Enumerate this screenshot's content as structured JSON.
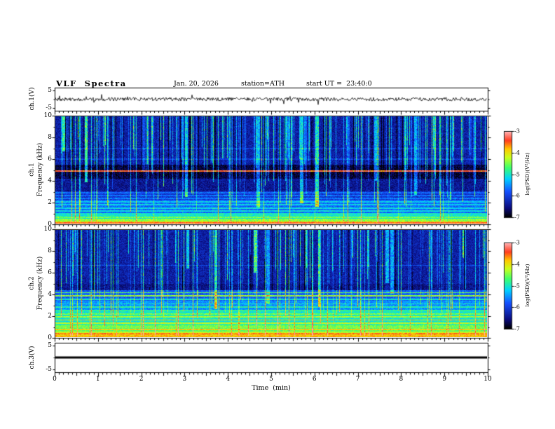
{
  "header": {
    "title": "VLF  Spectra",
    "date": "Jan. 20, 2026",
    "station": "station=ATH",
    "start_ut": "start UT =  23:40:0"
  },
  "axes": {
    "x_title": "Time  (min)",
    "x_tick_labels": [
      "0",
      "1",
      "2",
      "3",
      "4",
      "5",
      "6",
      "7",
      "8",
      "9",
      "10"
    ],
    "spec_y_tick_labels": [
      "10",
      "8",
      "6",
      "4",
      "2",
      "0"
    ],
    "volt_y_tick_labels": [
      "5",
      "-5"
    ],
    "colorbar_tick_labels": [
      "-3",
      "-4",
      "-5",
      "-6",
      "-7"
    ],
    "colorbar_title": "log(PSD)(V²/Hz)"
  },
  "panel_labels": {
    "ch1_wave": "ch.1(V)",
    "spec1_line1": "ch.1",
    "spec1_line2": "Frequency (kHz)",
    "spec2_line1": "ch.2",
    "spec2_line2": "Frequency (kHz)",
    "ch3_wave": "ch.3(V)"
  },
  "colors": {
    "background": "#ffffff",
    "frame": "#000000",
    "trace": "#000000",
    "colormap_stops": [
      [
        0.0,
        "#000000"
      ],
      [
        0.1,
        "#0a0a78"
      ],
      [
        0.3,
        "#1450ff"
      ],
      [
        0.45,
        "#00d2ff"
      ],
      [
        0.58,
        "#3cff6e"
      ],
      [
        0.7,
        "#c8ff1e"
      ],
      [
        0.8,
        "#ffc800"
      ],
      [
        0.9,
        "#ff3c1e"
      ],
      [
        1.0,
        "#ffaaaa"
      ]
    ]
  },
  "chart_data": [
    {
      "type": "line",
      "name": "ch1-voltage-waveform",
      "ylabel": "ch.1(V)",
      "xlim": [
        0,
        10
      ],
      "ylim": [
        -5,
        5
      ],
      "yticks": [
        5,
        -5
      ],
      "baseline_v": 0,
      "noise_amplitude_v": 0.8,
      "spike_rate": 0.035,
      "spike_amplitude_v": 2.5,
      "description": "continuous broadband noise trace centered on 0 V with sporadic impulsive spikes"
    },
    {
      "type": "heatmap",
      "name": "ch1-spectrogram",
      "ylabel": "ch.1 Frequency (kHz)",
      "xlim": [
        0,
        10
      ],
      "ylim": [
        0,
        10
      ],
      "yticks": [
        0,
        2,
        4,
        6,
        8,
        10
      ],
      "clim": [
        -7,
        -3
      ],
      "colorbar_label": "log(PSD)(V²/Hz)",
      "noise": 0.55,
      "bands": [
        {
          "f": [
            0,
            0.2
          ],
          "psd": -3.8
        },
        {
          "f": [
            0.2,
            0.45
          ],
          "psd": -4.4
        },
        {
          "f": [
            0.45,
            1.0
          ],
          "psd": -5.0
        },
        {
          "f": [
            1.0,
            2.2
          ],
          "psd": -5.7
        },
        {
          "f": [
            2.2,
            3.0
          ],
          "psd": -6.1
        },
        {
          "f": [
            3.0,
            4.2
          ],
          "psd": -6.45
        },
        {
          "f": [
            4.2,
            5.5
          ],
          "psd": -6.8
        },
        {
          "f": [
            5.5,
            10.01
          ],
          "psd": -6.35
        }
      ],
      "lines": [
        {
          "f": 0.08,
          "psd": -3.5
        },
        {
          "f": 0.6,
          "psd": -4.5
        },
        {
          "f": 1.15,
          "psd": -5.1
        },
        {
          "f": 1.45,
          "psd": -5.1
        },
        {
          "f": 1.75,
          "psd": -5.15
        },
        {
          "f": 2.0,
          "psd": -5.2
        },
        {
          "f": 2.35,
          "psd": -5.6
        },
        {
          "f": 2.6,
          "psd": -5.65
        },
        {
          "f": 2.85,
          "psd": -5.7
        },
        {
          "f": 4.9,
          "psd": -3.4
        },
        {
          "f": 6.0,
          "psd": -6.0
        },
        {
          "f": 7.0,
          "psd": -6.05
        }
      ],
      "streaks": {
        "prob": 0.3,
        "burst_prob": 0.02,
        "dark_prob": 0.1,
        "boost": [
          0.6,
          2.2
        ]
      },
      "description": "blue background with dense vertical sferic streaks above ~5 kHz, dark band 4.2-5.5 kHz, bright green/yellow/red layers below 1 kHz"
    },
    {
      "type": "heatmap",
      "name": "ch2-spectrogram",
      "ylabel": "ch.2 Frequency (kHz)",
      "xlim": [
        0,
        10
      ],
      "ylim": [
        0,
        10
      ],
      "yticks": [
        0,
        2,
        4,
        6,
        8,
        10
      ],
      "clim": [
        -7,
        -3
      ],
      "colorbar_label": "log(PSD)(V²/Hz)",
      "noise": 0.55,
      "bands": [
        {
          "f": [
            0,
            0.25
          ],
          "psd": -3.8
        },
        {
          "f": [
            0.25,
            0.5
          ],
          "psd": -4.2
        },
        {
          "f": [
            0.5,
            1.2
          ],
          "psd": -4.6
        },
        {
          "f": [
            1.2,
            2.4
          ],
          "psd": -5.0
        },
        {
          "f": [
            2.4,
            3.4
          ],
          "psd": -5.5
        },
        {
          "f": [
            3.4,
            4.4
          ],
          "psd": -5.8
        },
        {
          "f": [
            4.4,
            5.0
          ],
          "psd": -6.5
        },
        {
          "f": [
            5.0,
            10.01
          ],
          "psd": -6.35
        }
      ],
      "lines": [
        {
          "f": 0.35,
          "psd": -3.6
        },
        {
          "f": 0.7,
          "psd": -3.9
        },
        {
          "f": 0.95,
          "psd": -4.2
        },
        {
          "f": 1.3,
          "psd": -4.2
        },
        {
          "f": 1.6,
          "psd": -3.9
        },
        {
          "f": 1.9,
          "psd": -4.3
        },
        {
          "f": 2.15,
          "psd": -4.5
        },
        {
          "f": 2.5,
          "psd": -4.8
        },
        {
          "f": 2.8,
          "psd": -4.9
        },
        {
          "f": 3.1,
          "psd": -5.0
        },
        {
          "f": 3.55,
          "psd": -5.0
        },
        {
          "f": 3.85,
          "psd": -4.4
        },
        {
          "f": 4.15,
          "psd": -4.6
        },
        {
          "f": 6.7,
          "psd": -5.9
        }
      ],
      "streaks": {
        "prob": 0.28,
        "burst_prob": 0.02,
        "dark_prob": 0.08,
        "boost": [
          0.6,
          2.2
        ]
      },
      "description": "same sferic streak pattern above 5 kHz; strong layered green/yellow/orange horizontal banding from 0 to ~4.4 kHz"
    },
    {
      "type": "line",
      "name": "ch3-voltage-flat",
      "ylabel": "ch.3(V)",
      "xlim": [
        0,
        10
      ],
      "ylim": [
        -5,
        5
      ],
      "yticks": [
        5,
        -5
      ],
      "value_v": 0,
      "line_thickness_px": 3,
      "description": "flat/saturated channel drawn as a solid thick black line at 0 V"
    }
  ]
}
